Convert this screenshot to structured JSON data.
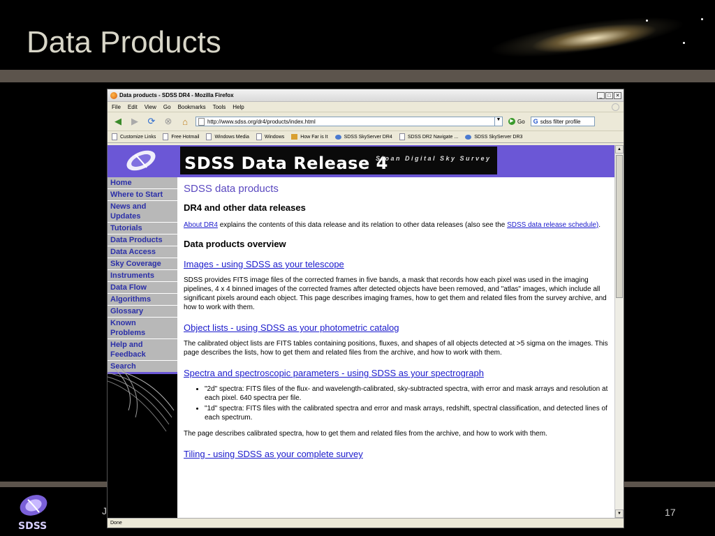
{
  "slide": {
    "title": "Data Products",
    "footer_partial": "J",
    "page_number": "17"
  },
  "browser": {
    "title": "Data products - SDSS DR4 - Mozilla Firefox",
    "menu": [
      "File",
      "Edit",
      "View",
      "Go",
      "Bookmarks",
      "Tools",
      "Help"
    ],
    "url": "http://www.sdss.org/dr4/products/index.html",
    "go_label": "Go",
    "search_value": "sdss filter profile",
    "bookmarks": [
      {
        "label": "Customize Links",
        "icon": "page"
      },
      {
        "label": "Free Hotmail",
        "icon": "page"
      },
      {
        "label": "Windows Media",
        "icon": "page"
      },
      {
        "label": "Windows",
        "icon": "page"
      },
      {
        "label": "How Far is It",
        "icon": "fav"
      },
      {
        "label": "SDSS SkyServer DR4",
        "icon": "sat"
      },
      {
        "label": "SDSS DR2 Navigate ...",
        "icon": "page"
      },
      {
        "label": "SDSS SkyServer DR3",
        "icon": "sat"
      }
    ],
    "status": "Done"
  },
  "site": {
    "banner_title": "SDSS Data Release 4",
    "banner_subtitle": "Sloan Digital Sky Survey",
    "nav": [
      "Home",
      "Where to Start",
      "News and Updates",
      "Tutorials",
      "Data Products",
      "Data Access",
      "Sky Coverage",
      "Instruments",
      "Data Flow",
      "Algorithms",
      "Glossary",
      "Known Problems",
      "Help and Feedback",
      "Search"
    ]
  },
  "page": {
    "heading": "SDSS data products",
    "sub1": "DR4 and other data releases",
    "about_link": "About DR4",
    "about_text": " explains the contents of this data release and its relation to other data releases (also see the ",
    "schedule_link": "SDSS data release schedule)",
    "about_end": ".",
    "sub2": "Data products overview",
    "images_link": "Images - using SDSS as your telescope",
    "images_text": "SDSS provides FITS image files of the corrected frames in five bands, a mask that records how each pixel was used in the imaging pipelines, 4 x 4 binned images of the corrected frames after detected objects have been removed, and \"atlas\" images, which include all significant pixels around each object. This page describes imaging frames, how to get them and related files from the survey archive, and how to work with them.",
    "objects_link": "Object lists - using SDSS as your photometric catalog",
    "objects_text": "The calibrated object lists are FITS tables containing positions, fluxes, and shapes of all objects detected at >5 sigma on the images. This page describes the lists, how to get them and related files from the archive, and how to work with them.",
    "spectra_link": "Spectra and spectroscopic parameters - using SDSS as your spectrograph",
    "spectra_items": [
      "\"2d\" spectra: FITS files of the flux- and wavelength-calibrated, sky-subtracted spectra, with error and mask arrays and resolution at each pixel. 640 spectra per file.",
      "\"1d\" spectra: FITS files with the calibrated spectra and error and mask arrays, redshift, spectral classification, and detected lines of each spectrum."
    ],
    "spectra_text": "The page describes calibrated spectra, how to get them and related files from the archive, and how to work with them.",
    "tiling_link": "Tiling - using SDSS as your complete survey"
  }
}
